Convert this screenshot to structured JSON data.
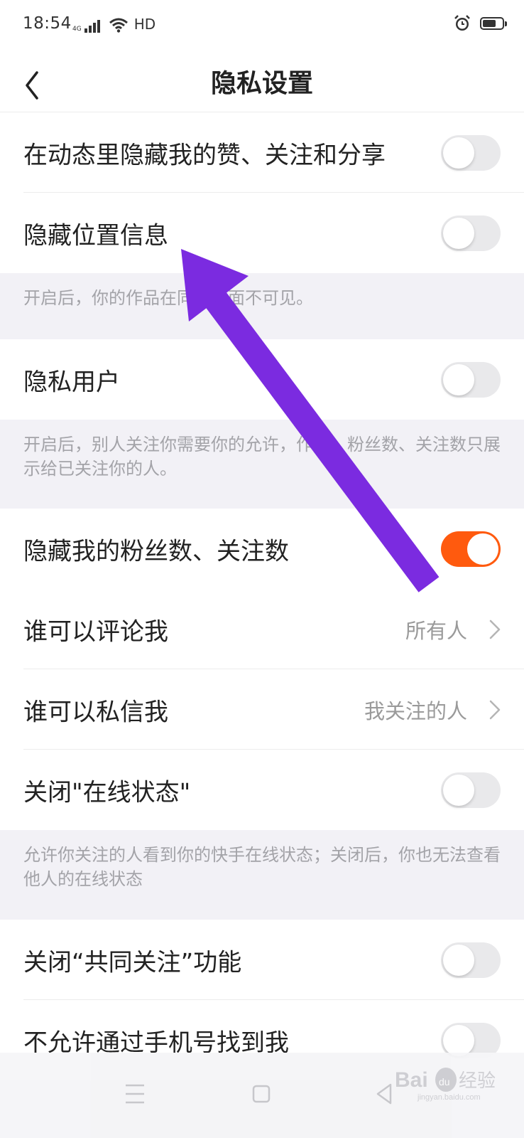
{
  "status_bar": {
    "time": "18:54",
    "network": "4G",
    "hd": "HD"
  },
  "header": {
    "title": "隐私设置"
  },
  "settings": [
    {
      "label": "在动态里隐藏我的赞、关注和分享",
      "toggle": "off"
    },
    {
      "label": "隐藏位置信息",
      "toggle": "off"
    },
    {
      "label": "隐私用户",
      "toggle": "off"
    },
    {
      "label": "隐藏我的粉丝数、关注数",
      "toggle": "on"
    },
    {
      "label": "谁可以评论我",
      "value": "所有人"
    },
    {
      "label": "谁可以私信我",
      "value": "我关注的人"
    },
    {
      "label": "关闭\"在线状态\"",
      "toggle": "off"
    },
    {
      "label": "关闭“共同关注”功能",
      "toggle": "off"
    },
    {
      "label": "不允许通过手机号找到我",
      "toggle": "off"
    }
  ],
  "descriptions": {
    "location": "开启后，你的作品在同城页面不可见。",
    "private_user": "开启后，别人关注你需要你的允许，作品、粉丝数、关注数只展示给已关注你的人。",
    "online_status": "允许你关注的人看到你的快手在线状态；关闭后，你也无法查看他人的在线状态"
  },
  "colors": {
    "accent": "#ff5a0e",
    "annotation_arrow": "#7b2be0",
    "background": "#f2f1f6"
  },
  "watermark": {
    "text": "Bai du 经验",
    "sub": "jingyan.baidu.com"
  }
}
